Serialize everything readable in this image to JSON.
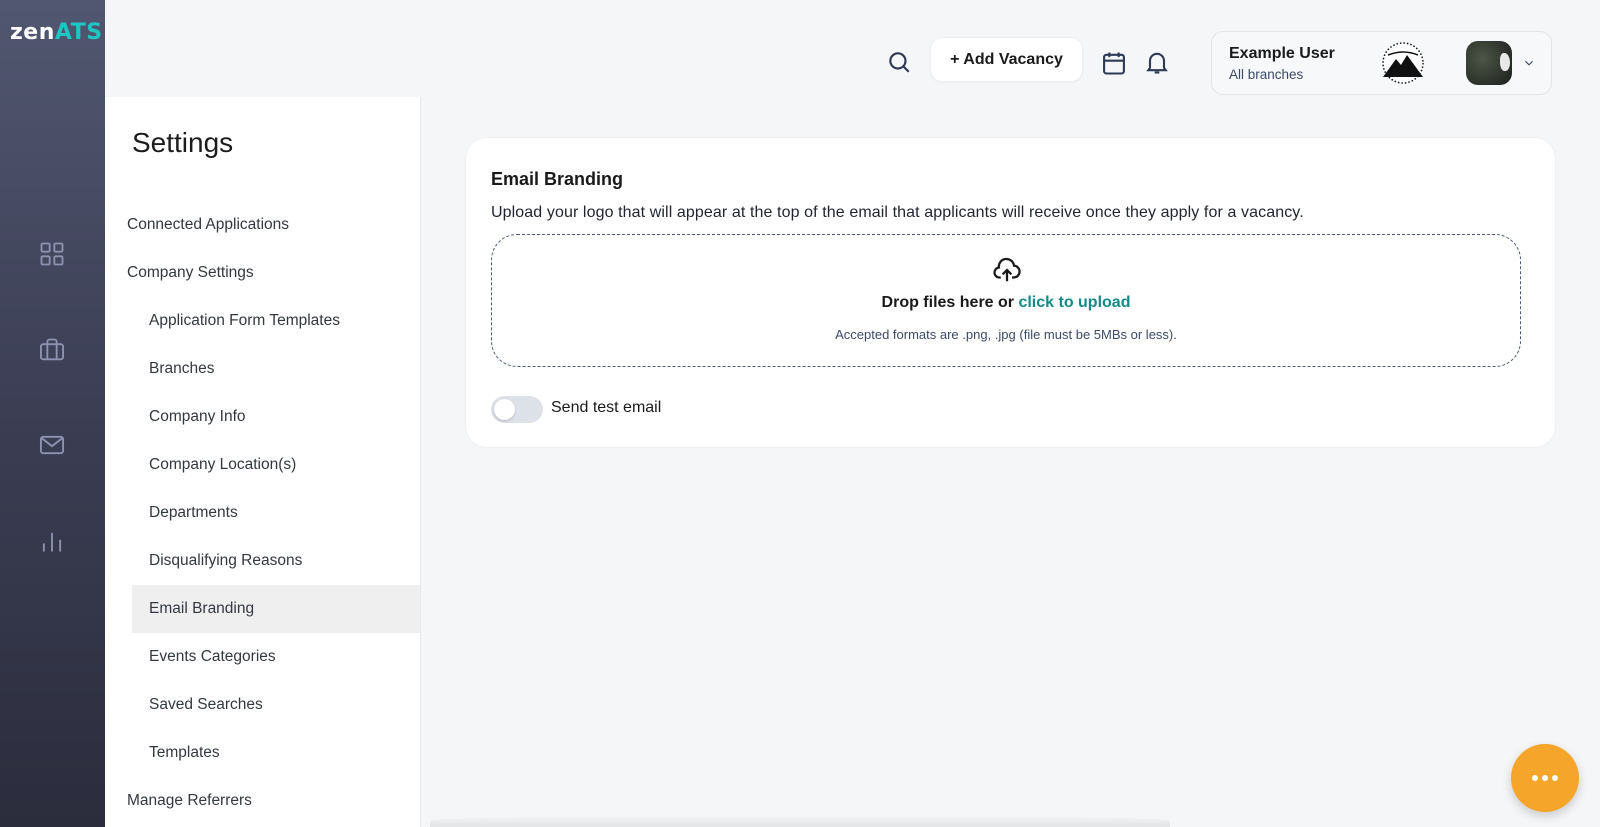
{
  "brand": {
    "part1": "zen",
    "part2": "ATS"
  },
  "rail": {
    "icons": [
      "dashboard-icon",
      "briefcase-icon",
      "mail-icon",
      "analytics-icon"
    ]
  },
  "header": {
    "add_vacancy_label": "+ Add Vacancy",
    "user": {
      "name": "Example User",
      "branch": "All branches"
    }
  },
  "settings": {
    "title": "Settings",
    "items": [
      {
        "label": "Connected Applications",
        "level": "top"
      },
      {
        "label": "Company Settings",
        "level": "top"
      },
      {
        "label": "Application Form Templates",
        "level": "sub"
      },
      {
        "label": "Branches",
        "level": "sub"
      },
      {
        "label": "Company Info",
        "level": "sub"
      },
      {
        "label": "Company Location(s)",
        "level": "sub"
      },
      {
        "label": "Departments",
        "level": "sub"
      },
      {
        "label": "Disqualifying Reasons",
        "level": "sub"
      },
      {
        "label": "Email Branding",
        "level": "sub",
        "active": true
      },
      {
        "label": "Events Categories",
        "level": "sub"
      },
      {
        "label": "Saved Searches",
        "level": "sub"
      },
      {
        "label": "Templates",
        "level": "sub"
      },
      {
        "label": "Manage Referrers",
        "level": "top"
      }
    ]
  },
  "email_branding": {
    "title": "Email Branding",
    "description": "Upload your logo that will appear at the top of the email that applicants will receive once they apply for a vacancy.",
    "drop_text": "Drop files here or ",
    "drop_link": "click to upload",
    "drop_hint": "Accepted formats are .png, .jpg (file must be 5MBs or less).",
    "toggle_label": "Send test email",
    "toggle_on": false
  },
  "colors": {
    "accent_teal": "#138a8a",
    "fab": "#f4a52a",
    "rail_top": "#525771",
    "rail_bottom": "#2b2d3d"
  }
}
